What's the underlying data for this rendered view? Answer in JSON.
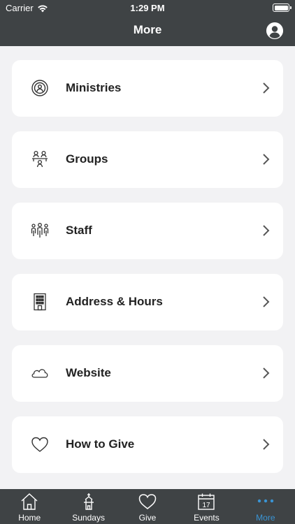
{
  "status": {
    "carrier": "Carrier",
    "time": "1:29 PM"
  },
  "header": {
    "title": "More"
  },
  "menu": {
    "items": [
      {
        "label": "Ministries",
        "icon": "ministries-icon"
      },
      {
        "label": "Groups",
        "icon": "groups-icon"
      },
      {
        "label": "Staff",
        "icon": "staff-icon"
      },
      {
        "label": "Address & Hours",
        "icon": "building-icon"
      },
      {
        "label": "Website",
        "icon": "cloud-icon"
      },
      {
        "label": "How to Give",
        "icon": "heart-icon"
      }
    ]
  },
  "tabbar": {
    "tabs": [
      {
        "label": "Home",
        "icon": "home-icon"
      },
      {
        "label": "Sundays",
        "icon": "church-icon"
      },
      {
        "label": "Give",
        "icon": "heart-icon"
      },
      {
        "label": "Events",
        "icon": "calendar-icon",
        "calendar_day": "17"
      },
      {
        "label": "More",
        "icon": "more-dots-icon",
        "active": true
      }
    ],
    "active_color": "#3a94d4"
  },
  "colors": {
    "bar": "#3f4345",
    "background": "#f2f2f4",
    "card": "#ffffff"
  }
}
